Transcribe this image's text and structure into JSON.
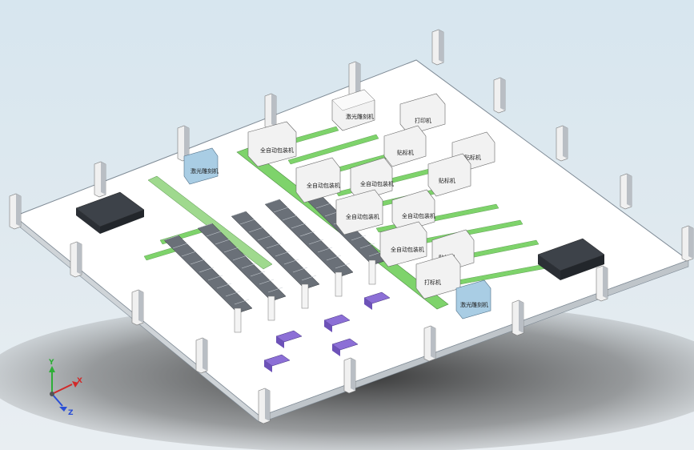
{
  "viewport": {
    "background_top": "#d7e6ef",
    "background_bottom": "#e9eef2"
  },
  "colors": {
    "floor": "#ffffff",
    "floor_edge": "#7e8a95",
    "shadow": "#3a3a3a",
    "conveyor": "#7ed36b",
    "machine_face": "#f3f3f3",
    "machine_side": "#c9cdd2",
    "cabinet_blue": "#a9cde4",
    "rack_dark": "#4a4f57",
    "pillar": "#f0f0f0",
    "pillar_side": "#b9bec4",
    "accent_yellow": "#e7cf5a",
    "accent_purple": "#8c6fd6"
  },
  "machines": {
    "m1": "激光雕刻机",
    "m2": "打印机",
    "m3": "全自动包装机",
    "m4": "贴标机",
    "m5": "贴标机",
    "m6": "激光雕刻机",
    "m7": "全自动包装机",
    "m8": "全自动包装机",
    "m9": "贴标机",
    "m10": "全自动包装机",
    "m11": "全自动包装机",
    "m12": "全自动包装机",
    "m13": "贴标机",
    "m14": "打标机",
    "m15": "激光雕刻机"
  },
  "axis_triad": {
    "x_label": "X",
    "y_label": "Y",
    "z_label": "Z",
    "x_color": "#d12a2a",
    "y_color": "#2eae37",
    "z_color": "#2a4fd6"
  }
}
